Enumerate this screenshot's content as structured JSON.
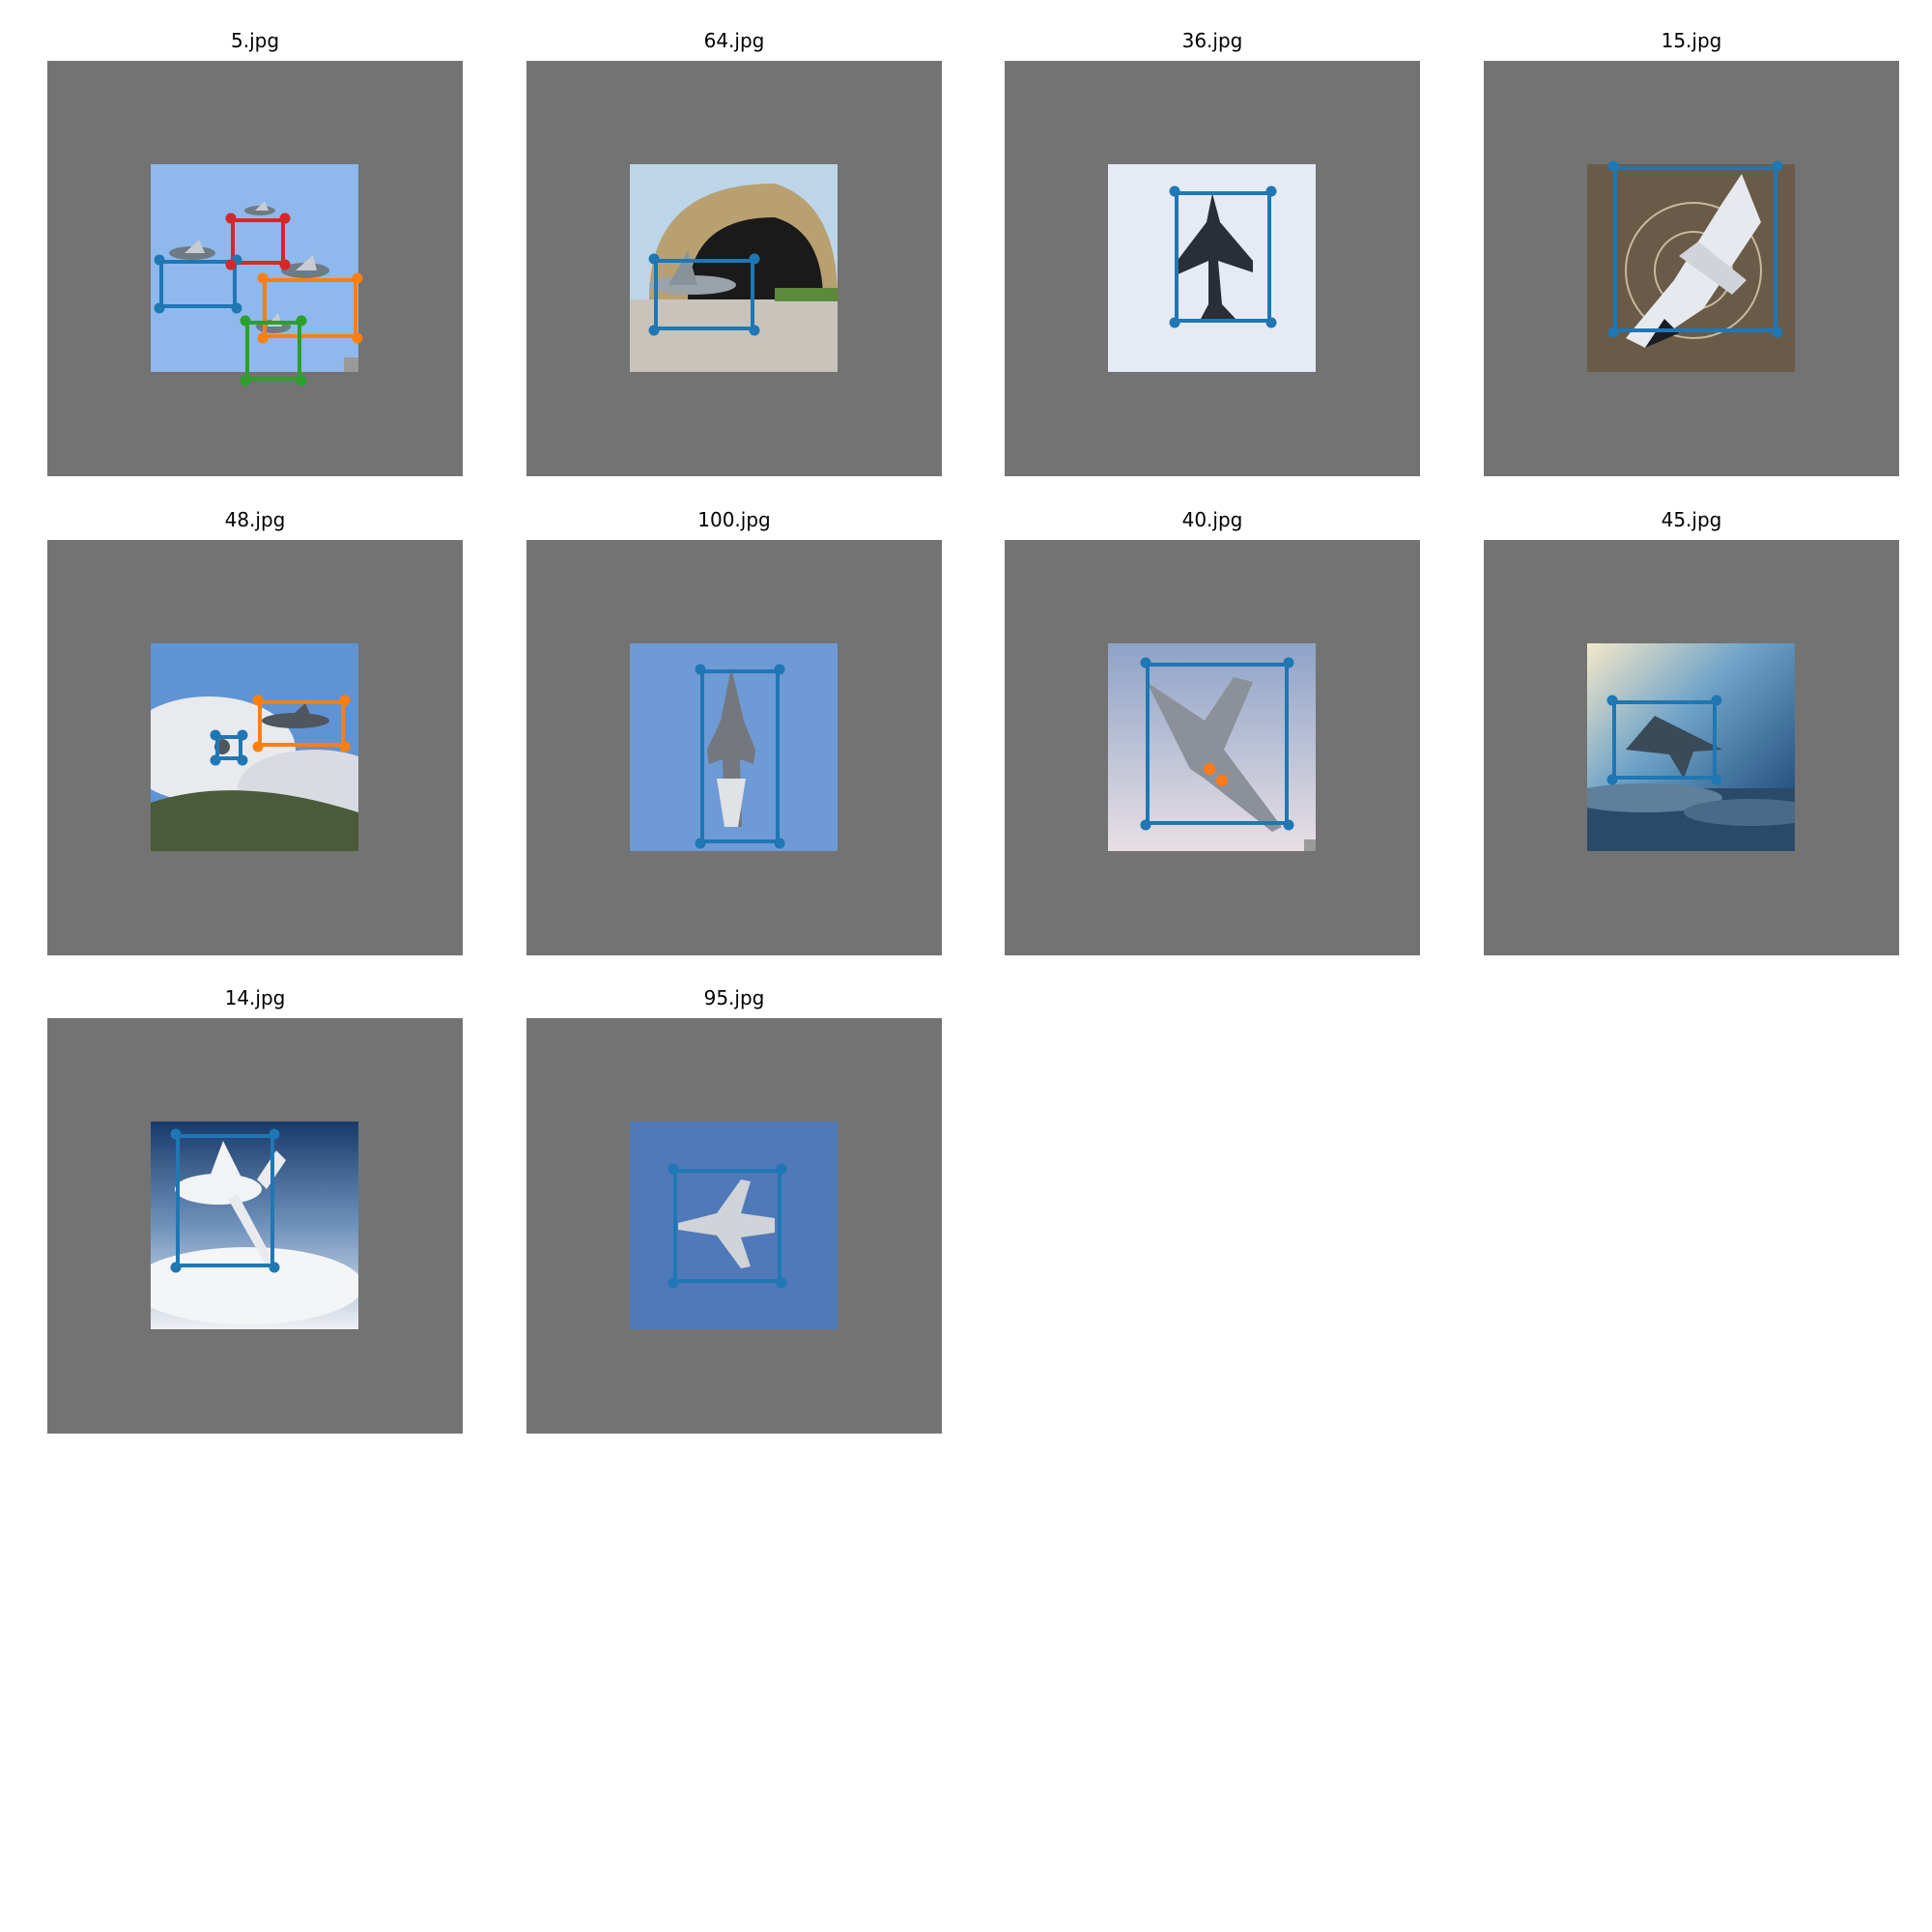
{
  "colors": {
    "canvas_bg": "#737373",
    "box_blue": "#1f77b4",
    "box_orange": "#ff7f0e",
    "box_green": "#2ca02c",
    "box_red": "#d62728"
  },
  "panels": [
    {
      "title": "5.jpg",
      "boxes": [
        "blue",
        "orange",
        "green",
        "red"
      ]
    },
    {
      "title": "64.jpg",
      "boxes": [
        "blue"
      ]
    },
    {
      "title": "36.jpg",
      "boxes": [
        "blue"
      ]
    },
    {
      "title": "15.jpg",
      "boxes": [
        "blue"
      ]
    },
    {
      "title": "48.jpg",
      "boxes": [
        "blue",
        "orange"
      ]
    },
    {
      "title": "100.jpg",
      "boxes": [
        "blue"
      ]
    },
    {
      "title": "40.jpg",
      "boxes": [
        "blue"
      ]
    },
    {
      "title": "45.jpg",
      "boxes": [
        "blue"
      ]
    },
    {
      "title": "14.jpg",
      "boxes": [
        "blue"
      ]
    },
    {
      "title": "95.jpg",
      "boxes": [
        "blue"
      ]
    }
  ]
}
